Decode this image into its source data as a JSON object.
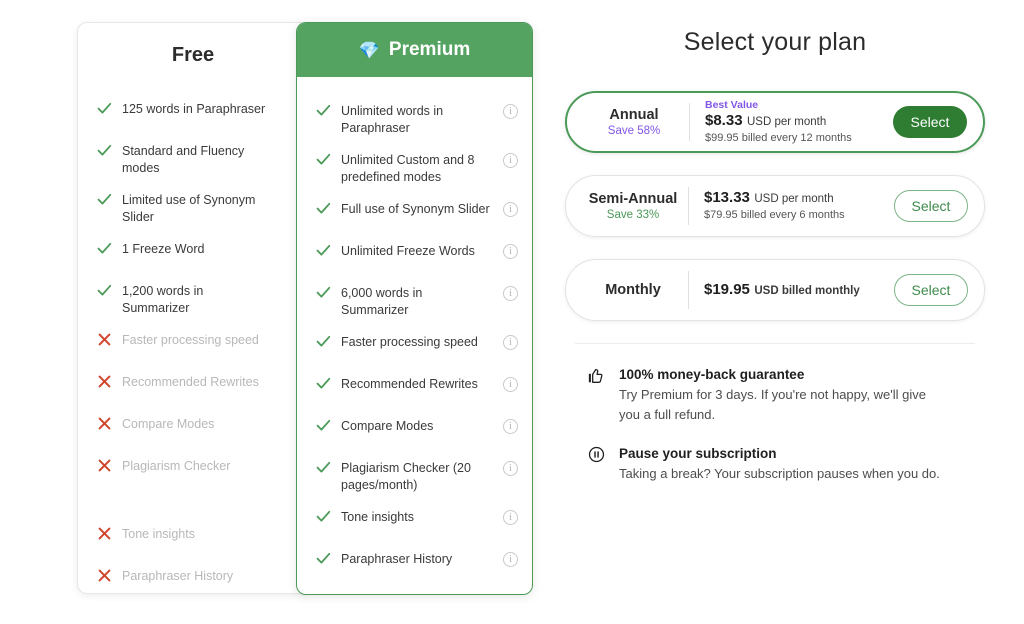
{
  "comparison": {
    "free": {
      "title": "Free",
      "features": [
        {
          "text": "125 words in Paraphraser",
          "included": true
        },
        {
          "text": "Standard and Fluency modes",
          "included": true
        },
        {
          "text": "Limited use of Synonym Slider",
          "included": true
        },
        {
          "text": "1 Freeze Word",
          "included": true
        },
        {
          "text": "1,200 words in Summarizer",
          "included": true
        },
        {
          "text": "Faster processing speed",
          "included": false
        },
        {
          "text": "Recommended Rewrites",
          "included": false
        },
        {
          "text": "Compare Modes",
          "included": false
        },
        {
          "text": "Plagiarism Checker",
          "included": false
        },
        {
          "text": "Tone insights",
          "included": false,
          "extra_gap": true
        },
        {
          "text": "Paraphraser History",
          "included": false
        }
      ]
    },
    "premium": {
      "title": "Premium",
      "icon": "gem-icon",
      "features": [
        {
          "text": "Unlimited words in Paraphraser",
          "included": true,
          "info": true
        },
        {
          "text": "Unlimited Custom and 8 predefined modes",
          "included": true,
          "info": true
        },
        {
          "text": "Full use of Synonym Slider",
          "included": true,
          "info": true
        },
        {
          "text": "Unlimited Freeze Words",
          "included": true,
          "info": true
        },
        {
          "text": "6,000 words in Summarizer",
          "included": true,
          "info": true
        },
        {
          "text": "Faster processing speed",
          "included": true,
          "info": true
        },
        {
          "text": "Recommended Rewrites",
          "included": true,
          "info": true
        },
        {
          "text": "Compare Modes",
          "included": true,
          "info": true
        },
        {
          "text": "Plagiarism Checker (20 pages/month)",
          "included": true,
          "info": true
        },
        {
          "text": "Tone insights",
          "included": true,
          "info": true
        },
        {
          "text": "Paraphraser History",
          "included": true,
          "info": true
        }
      ]
    }
  },
  "plan_panel": {
    "title": "Select your plan",
    "plans": [
      {
        "name": "Annual",
        "save": "Save 58%",
        "save_color": "purple",
        "badge": "Best Value",
        "price": "$8.33",
        "price_unit": "USD per month",
        "billed": "$99.95 billed every 12 months",
        "button": "Select",
        "selected": true
      },
      {
        "name": "Semi-Annual",
        "save": "Save 33%",
        "save_color": "green",
        "badge": "",
        "price": "$13.33",
        "price_unit": "USD per month",
        "billed": "$79.95 billed every 6 months",
        "button": "Select",
        "selected": false
      },
      {
        "name": "Monthly",
        "save": "",
        "save_color": "green",
        "badge": "",
        "price": "$19.95",
        "price_unit": "USD billed monthly",
        "billed": "",
        "button": "Select",
        "selected": false
      }
    ],
    "promos": [
      {
        "icon": "thumbs-up-icon",
        "title": "100% money-back guarantee",
        "desc": "Try Premium for 3 days. If you're not happy, we'll give you a full refund."
      },
      {
        "icon": "pause-circle-icon",
        "title": "Pause your subscription",
        "desc": "Taking a break? Your subscription pauses when you do."
      }
    ]
  },
  "colors": {
    "premium_header_green": "#55a361",
    "premium_border_green": "#4b9a58",
    "select_filled_green": "#2e7d32",
    "select_outline_green": "#3f8b4c",
    "purple": "#8257e6",
    "check_green": "#4b9a58",
    "cross_red": "#d0452b",
    "muted_text": "#b8b8b8"
  }
}
